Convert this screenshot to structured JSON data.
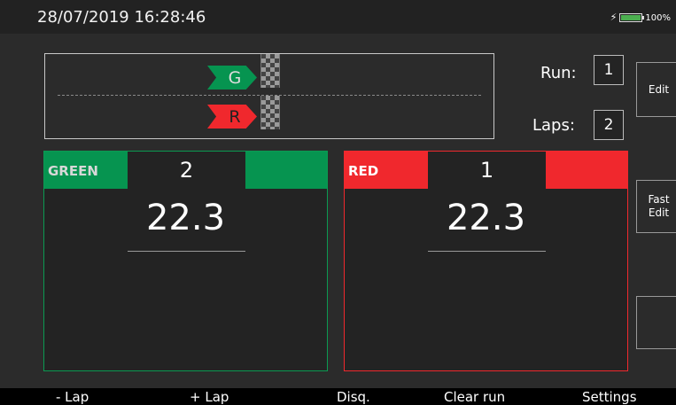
{
  "status": {
    "datetime": "28/07/2019 16:28:46",
    "battery_percent_label": "100%",
    "battery_level": 1.0,
    "charging_icon": "plug-icon"
  },
  "track": {
    "lanes": [
      {
        "flag_letter": "G",
        "color": "#069450"
      },
      {
        "flag_letter": "R",
        "color": "#f0282d"
      }
    ]
  },
  "controls": {
    "run_label": "Run:",
    "run_value": "1",
    "laps_label": "Laps:",
    "laps_value": "2"
  },
  "side_buttons": {
    "edit": "Edit",
    "fast_edit_line1": "Fast",
    "fast_edit_line2": "Edit",
    "blank": ""
  },
  "lanes": {
    "green": {
      "name": "GREEN",
      "count": "2",
      "time": "22.3",
      "color": "#069450"
    },
    "red": {
      "name": "RED",
      "count": "1",
      "time": "22.3",
      "color": "#f0282d"
    }
  },
  "bottom_bar": {
    "minus_lap": "- Lap",
    "plus_lap": "+ Lap",
    "disq": "Disq.",
    "clear_run": "Clear run",
    "settings": "Settings"
  }
}
